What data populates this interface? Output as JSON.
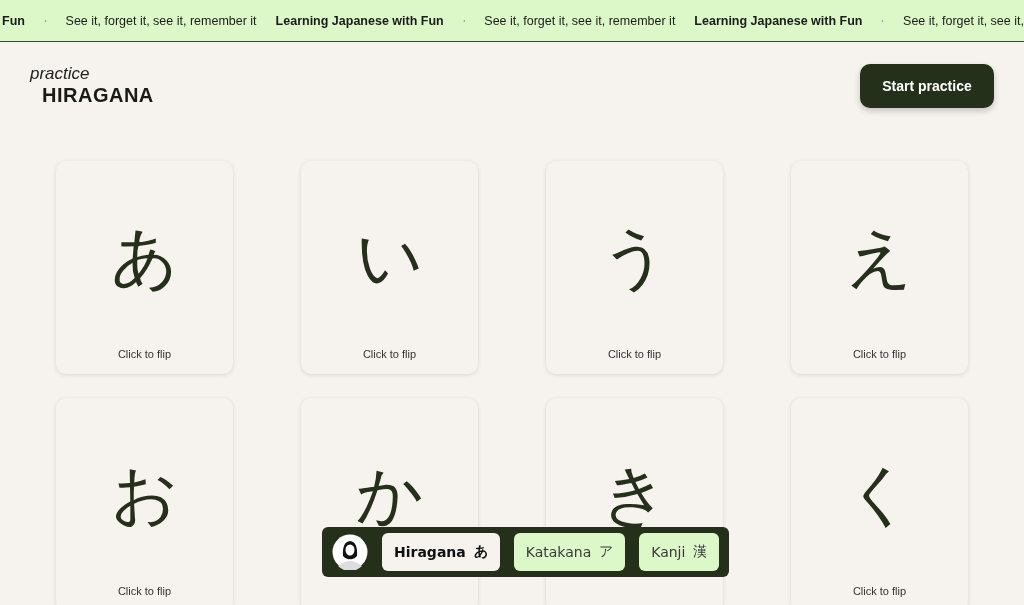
{
  "marquee": [
    {
      "kind": "title",
      "text": "Fun"
    },
    {
      "kind": "flag"
    },
    {
      "kind": "slogan",
      "text": "See it, forget it, see it, remember it"
    },
    {
      "kind": "title",
      "text": "Learning Japanese with Fun"
    },
    {
      "kind": "flag"
    },
    {
      "kind": "slogan",
      "text": "See it, forget it, see it, remember it"
    },
    {
      "kind": "title",
      "text": "Learning Japanese with Fun"
    },
    {
      "kind": "flag"
    },
    {
      "kind": "slogan",
      "text": "See it, forget it, see it,"
    }
  ],
  "header": {
    "subtitle": "practice",
    "title": "HIRAGANA",
    "button": "Start practice"
  },
  "cards": [
    {
      "kana": "あ",
      "caption": "Click to flip"
    },
    {
      "kana": "い",
      "caption": "Click to flip"
    },
    {
      "kana": "う",
      "caption": "Click to flip"
    },
    {
      "kana": "え",
      "caption": "Click to flip"
    },
    {
      "kana": "お",
      "caption": "Click to flip"
    },
    {
      "kana": "か"
    },
    {
      "kana": "き"
    },
    {
      "kana": "く",
      "caption": "Click to flip"
    }
  ],
  "nav": {
    "tabs": [
      {
        "label": "Hiragana",
        "glyph": "あ",
        "selected": true
      },
      {
        "label": "Katakana",
        "glyph": "ア",
        "selected": false
      },
      {
        "label": "Kanji",
        "glyph": "漢",
        "selected": false
      }
    ]
  }
}
